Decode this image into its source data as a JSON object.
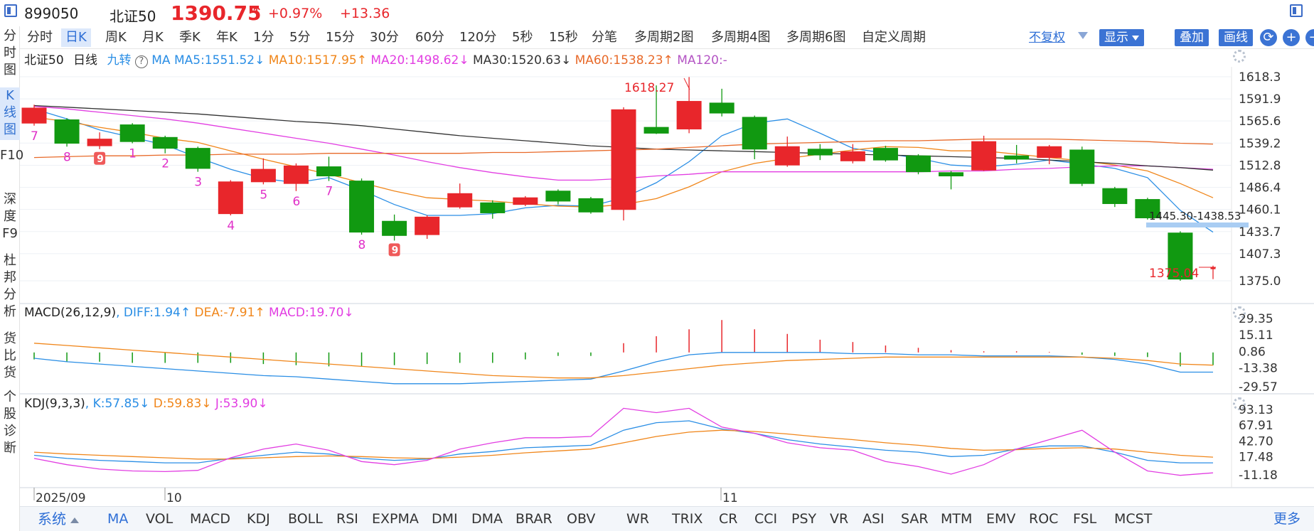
{
  "header": {
    "code": "899050",
    "name": "北证50",
    "price": "1390.75",
    "arrow": "↑",
    "change_pct": "+0.97%",
    "change": "+13.36"
  },
  "left_tabs": [
    {
      "label": "分时图"
    },
    {
      "label": "K线图",
      "active": true
    },
    {
      "label": "F10"
    },
    {
      "label": "深度F9"
    },
    {
      "label": "杜邦分析"
    },
    {
      "label": "货比货"
    },
    {
      "label": "个股诊断"
    }
  ],
  "periods": [
    {
      "label": "分时"
    },
    {
      "label": "日K",
      "active": true
    },
    {
      "label": "周K"
    },
    {
      "label": "月K"
    },
    {
      "label": "季K"
    },
    {
      "label": "年K"
    },
    {
      "label": "1分"
    },
    {
      "label": "5分"
    },
    {
      "label": "15分"
    },
    {
      "label": "30分"
    },
    {
      "label": "60分"
    },
    {
      "label": "120分"
    },
    {
      "label": "5秒"
    },
    {
      "label": "15秒"
    },
    {
      "label": "分笔"
    },
    {
      "label": "多周期2图"
    },
    {
      "label": "多周期4图"
    },
    {
      "label": "多周期6图"
    },
    {
      "label": "自定义周期"
    }
  ],
  "toolbar_right": {
    "adjust": "不复权",
    "display": "显示",
    "overlay": "叠加",
    "draw": "画线",
    "refresh_icon": "refresh-icon",
    "zoom_in": "+",
    "zoom_out": "−"
  },
  "main_legend": {
    "name": "北证50",
    "period": "日线",
    "nine": "九转",
    "ma": "MA",
    "ma5": "MA5:1551.52↓",
    "ma10": "MA10:1517.95↑",
    "ma20": "MA20:1498.62↓",
    "ma30": "MA30:1520.63↓",
    "ma60": "MA60:1538.23↑",
    "ma120": "MA120:-"
  },
  "macd_legend": {
    "name": "MACD(26,12,9)",
    "diff": ", DIFF:1.94↑",
    "dea": " DEA:-7.91↑",
    "macd": " MACD:19.70↓"
  },
  "kdj_legend": {
    "name": "KDJ(9,3,3)",
    "k": ", K:57.85↓",
    "d": " D:59.83↓",
    "j": " J:53.90↓"
  },
  "colors": {
    "up": "#e8262b",
    "down": "#119911",
    "ma5": "#2a8ee5",
    "ma10": "#f0861a",
    "ma20": "#e23ee2",
    "ma30": "#333333",
    "ma60": "#e86a2a",
    "highlight": "#a9cdf3"
  },
  "chart_data": [
    {
      "type": "candlestick",
      "title": "",
      "y_ticks": [
        "1618.3",
        "1591.9",
        "1565.6",
        "1539.2",
        "1512.8",
        "1486.4",
        "1460.1",
        "1433.7",
        "1407.3",
        "1375.0"
      ],
      "ylim": [
        1375.0,
        1618.3
      ],
      "x_ticks": [
        "2025/09",
        "10",
        "11"
      ],
      "annotations": {
        "high": "1618.27",
        "low": "1375.04",
        "range": "1445.30-1438.53",
        "nine_turn_labels": [
          "7",
          "8",
          "9",
          "1",
          "2",
          "3",
          "4",
          "5",
          "6",
          "7",
          "8",
          "9"
        ]
      },
      "candles": [
        {
          "o": 1563,
          "c": 1581,
          "h": 1585,
          "l": 1560
        },
        {
          "o": 1567,
          "c": 1539,
          "h": 1569,
          "l": 1535
        },
        {
          "o": 1536,
          "c": 1544,
          "h": 1552,
          "l": 1532
        },
        {
          "o": 1561,
          "c": 1541,
          "h": 1563,
          "l": 1539
        },
        {
          "o": 1546,
          "c": 1533,
          "h": 1548,
          "l": 1527
        },
        {
          "o": 1533,
          "c": 1509,
          "h": 1535,
          "l": 1505
        },
        {
          "o": 1455,
          "c": 1493,
          "h": 1495,
          "l": 1453
        },
        {
          "o": 1493,
          "c": 1508,
          "h": 1521,
          "l": 1490
        },
        {
          "o": 1491,
          "c": 1512,
          "h": 1515,
          "l": 1482
        },
        {
          "o": 1511,
          "c": 1500,
          "h": 1523,
          "l": 1494
        },
        {
          "o": 1494,
          "c": 1433,
          "h": 1497,
          "l": 1430
        },
        {
          "o": 1446,
          "c": 1429,
          "h": 1454,
          "l": 1423
        },
        {
          "o": 1430,
          "c": 1451,
          "h": 1453,
          "l": 1425
        },
        {
          "o": 1463,
          "c": 1479,
          "h": 1491,
          "l": 1461
        },
        {
          "o": 1468,
          "c": 1456,
          "h": 1471,
          "l": 1449
        },
        {
          "o": 1466,
          "c": 1474,
          "h": 1476,
          "l": 1464
        },
        {
          "o": 1482,
          "c": 1470,
          "h": 1484,
          "l": 1466
        },
        {
          "o": 1473,
          "c": 1457,
          "h": 1475,
          "l": 1455
        },
        {
          "o": 1460,
          "c": 1579,
          "h": 1582,
          "l": 1447
        },
        {
          "o": 1558,
          "c": 1551,
          "h": 1608,
          "l": 1550
        },
        {
          "o": 1556,
          "c": 1589,
          "h": 1618,
          "l": 1551
        },
        {
          "o": 1587,
          "c": 1575,
          "h": 1604,
          "l": 1571
        },
        {
          "o": 1570,
          "c": 1532,
          "h": 1572,
          "l": 1520
        },
        {
          "o": 1513,
          "c": 1535,
          "h": 1547,
          "l": 1511
        },
        {
          "o": 1532,
          "c": 1525,
          "h": 1538,
          "l": 1519
        },
        {
          "o": 1518,
          "c": 1529,
          "h": 1538,
          "l": 1515
        },
        {
          "o": 1533,
          "c": 1519,
          "h": 1536,
          "l": 1517
        },
        {
          "o": 1524,
          "c": 1505,
          "h": 1526,
          "l": 1502
        },
        {
          "o": 1504,
          "c": 1500,
          "h": 1506,
          "l": 1484
        },
        {
          "o": 1507,
          "c": 1541,
          "h": 1548,
          "l": 1506
        },
        {
          "o": 1524,
          "c": 1520,
          "h": 1537,
          "l": 1515
        },
        {
          "o": 1522,
          "c": 1535,
          "h": 1537,
          "l": 1514
        },
        {
          "o": 1531,
          "c": 1491,
          "h": 1535,
          "l": 1488
        },
        {
          "o": 1485,
          "c": 1467,
          "h": 1487,
          "l": 1463
        },
        {
          "o": 1472,
          "c": 1450,
          "h": 1474,
          "l": 1448
        },
        {
          "o": 1432,
          "c": 1377,
          "h": 1434,
          "l": 1375.04
        },
        {
          "o": 1386,
          "c": 1391,
          "h": 1393,
          "l": 1377
        }
      ],
      "ma": {
        "MA5": [
          1580,
          1568,
          1555,
          1546,
          1537,
          1522,
          1508,
          1497,
          1492,
          1498,
          1483,
          1466,
          1453,
          1453,
          1455,
          1462,
          1465,
          1464,
          1474,
          1492,
          1517,
          1548,
          1563,
          1568,
          1551,
          1533,
          1527,
          1521,
          1513,
          1511,
          1514,
          1519,
          1514,
          1509,
          1498,
          1459,
          1433
        ],
        "MA10": [
          1570,
          1565,
          1558,
          1552,
          1545,
          1540,
          1530,
          1520,
          1511,
          1502,
          1492,
          1482,
          1474,
          1472,
          1470,
          1467,
          1464,
          1463,
          1466,
          1473,
          1487,
          1505,
          1515,
          1521,
          1526,
          1531,
          1535,
          1534,
          1530,
          1530,
          1526,
          1522,
          1518,
          1513,
          1506,
          1491,
          1474
        ],
        "MA20": [
          1583,
          1580,
          1576,
          1572,
          1568,
          1563,
          1557,
          1551,
          1545,
          1539,
          1532,
          1525,
          1517,
          1510,
          1504,
          1499,
          1495,
          1495,
          1497,
          1500,
          1502,
          1505,
          1505,
          1505,
          1505,
          1505,
          1505,
          1505,
          1506,
          1506,
          1508,
          1509,
          1511,
          1512,
          1512,
          1510,
          1508
        ],
        "MA30": [
          1584,
          1582,
          1580,
          1578,
          1576,
          1574,
          1571,
          1568,
          1565,
          1563,
          1560,
          1556,
          1552,
          1548,
          1545,
          1542,
          1539,
          1536,
          1534,
          1532,
          1531,
          1530,
          1529,
          1528,
          1527,
          1526,
          1525,
          1524,
          1523,
          1522,
          1521,
          1519,
          1517,
          1515,
          1512,
          1510,
          1507
        ],
        "MA60": [
          1522,
          1523,
          1524,
          1524,
          1525,
          1525,
          1526,
          1526,
          1526,
          1527,
          1527,
          1527,
          1527,
          1527,
          1528,
          1528,
          1529,
          1530,
          1531,
          1532,
          1534,
          1536,
          1538,
          1539,
          1540,
          1541,
          1542,
          1542,
          1543,
          1544,
          1544,
          1544,
          1543,
          1542,
          1541,
          1539,
          1538
        ]
      }
    },
    {
      "type": "bar",
      "title": "MACD(26,12,9)",
      "y_ticks": [
        "29.35",
        "15.11",
        "0.86",
        "-13.38",
        "-29.57"
      ],
      "ylim": [
        -29.57,
        29.35
      ],
      "macd": [
        -6,
        -8,
        -8,
        -9,
        -9,
        -9,
        -9,
        -10,
        -11,
        -12,
        -12,
        -11,
        -10,
        -9,
        -9,
        -6,
        -3,
        -3,
        8,
        14,
        20,
        28,
        20,
        16,
        11,
        9,
        6,
        4,
        2,
        1,
        1,
        0.5,
        -2,
        -3,
        -4,
        -12,
        -11
      ],
      "diff": [
        -5,
        -8,
        -10,
        -12,
        -14,
        -16,
        -18,
        -20,
        -21,
        -23,
        -25,
        -27,
        -27,
        -27,
        -26,
        -25,
        -24,
        -23,
        -16,
        -8,
        -2,
        0,
        0,
        0,
        0,
        -1,
        -1,
        -2,
        -2,
        -3,
        -3,
        -3,
        -4,
        -6,
        -10,
        -17,
        -17
      ],
      "dea": [
        8,
        6,
        4,
        2,
        0,
        -2,
        -4,
        -6,
        -8,
        -10,
        -12,
        -14,
        -16,
        -18,
        -20,
        -21,
        -22,
        -22,
        -20,
        -17,
        -14,
        -11,
        -9,
        -7,
        -6,
        -5,
        -4,
        -4,
        -4,
        -4,
        -4,
        -4,
        -4,
        -5,
        -7,
        -10,
        -11
      ]
    },
    {
      "type": "line",
      "title": "KDJ(9,3,3)",
      "y_ticks": [
        "93.13",
        "67.91",
        "42.70",
        "17.48",
        "-11.18"
      ],
      "ylim": [
        -11.18,
        93.13
      ],
      "K": [
        20,
        15,
        12,
        10,
        8,
        8,
        15,
        20,
        25,
        22,
        15,
        12,
        14,
        22,
        26,
        32,
        34,
        36,
        60,
        72,
        75,
        62,
        55,
        45,
        38,
        33,
        28,
        25,
        18,
        20,
        30,
        35,
        35,
        25,
        12,
        8,
        8
      ],
      "D": [
        25,
        22,
        20,
        18,
        16,
        14,
        14,
        16,
        18,
        19,
        18,
        16,
        15,
        17,
        20,
        24,
        27,
        30,
        40,
        50,
        57,
        60,
        58,
        54,
        49,
        45,
        40,
        36,
        31,
        28,
        29,
        31,
        32,
        30,
        25,
        20,
        17
      ],
      "J": [
        15,
        5,
        -2,
        -5,
        -6,
        -4,
        16,
        30,
        38,
        28,
        10,
        5,
        12,
        30,
        40,
        48,
        48,
        50,
        95,
        88,
        95,
        65,
        55,
        40,
        32,
        28,
        10,
        2,
        -10,
        5,
        30,
        45,
        60,
        25,
        -5,
        -12,
        -8
      ]
    }
  ],
  "indicators": [
    {
      "label": "系统"
    },
    {
      "label": "MA",
      "active": true
    },
    {
      "label": "VOL"
    },
    {
      "label": "MACD"
    },
    {
      "label": "KDJ"
    },
    {
      "label": "BOLL"
    },
    {
      "label": "RSI"
    },
    {
      "label": "EXPMA"
    },
    {
      "label": "DMI"
    },
    {
      "label": "DMA"
    },
    {
      "label": "BRAR"
    },
    {
      "label": "OBV"
    },
    {
      "label": "WR"
    },
    {
      "label": "TRIX"
    },
    {
      "label": "CR"
    },
    {
      "label": "CCI"
    },
    {
      "label": "PSY"
    },
    {
      "label": "VR"
    },
    {
      "label": "ASI"
    },
    {
      "label": "SAR"
    },
    {
      "label": "MTM"
    },
    {
      "label": "EMV"
    },
    {
      "label": "ROC"
    },
    {
      "label": "FSL"
    },
    {
      "label": "MCST"
    },
    {
      "label": "更多"
    }
  ]
}
